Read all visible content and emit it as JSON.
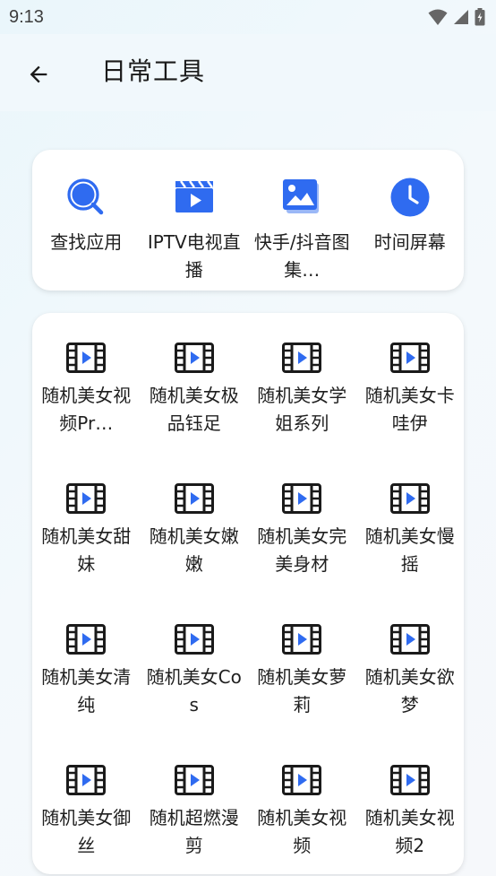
{
  "status_bar": {
    "time": "9:13"
  },
  "app_bar": {
    "title": "日常工具"
  },
  "colors": {
    "accent": "#2f6bf0",
    "icon_dark": "#1a1a1a"
  },
  "featured_tools": [
    {
      "label": "查找应用",
      "icon": "search-icon"
    },
    {
      "label": "IPTV电视直播",
      "icon": "clapperboard-icon"
    },
    {
      "label": "快手/抖音图集…",
      "icon": "image-gallery-icon"
    },
    {
      "label": "时间屏幕",
      "icon": "clock-icon"
    }
  ],
  "video_tools": [
    {
      "label": "随机美女视频Pr…",
      "icon": "video-film-icon"
    },
    {
      "label": "随机美女极品钰足",
      "icon": "video-film-icon"
    },
    {
      "label": "随机美女学姐系列",
      "icon": "video-film-icon"
    },
    {
      "label": "随机美女卡哇伊",
      "icon": "video-film-icon"
    },
    {
      "label": "随机美女甜妹",
      "icon": "video-film-icon"
    },
    {
      "label": "随机美女嫩嫩",
      "icon": "video-film-icon"
    },
    {
      "label": "随机美女完美身材",
      "icon": "video-film-icon"
    },
    {
      "label": "随机美女慢摇",
      "icon": "video-film-icon"
    },
    {
      "label": "随机美女清纯",
      "icon": "video-film-icon"
    },
    {
      "label": "随机美女Cos",
      "icon": "video-film-icon"
    },
    {
      "label": "随机美女萝莉",
      "icon": "video-film-icon"
    },
    {
      "label": "随机美女欲梦",
      "icon": "video-film-icon"
    },
    {
      "label": "随机美女御丝",
      "icon": "video-film-icon"
    },
    {
      "label": "随机超燃漫剪",
      "icon": "video-film-icon"
    },
    {
      "label": "随机美女视频",
      "icon": "video-film-icon"
    },
    {
      "label": "随机美女视频2",
      "icon": "video-film-icon"
    }
  ]
}
